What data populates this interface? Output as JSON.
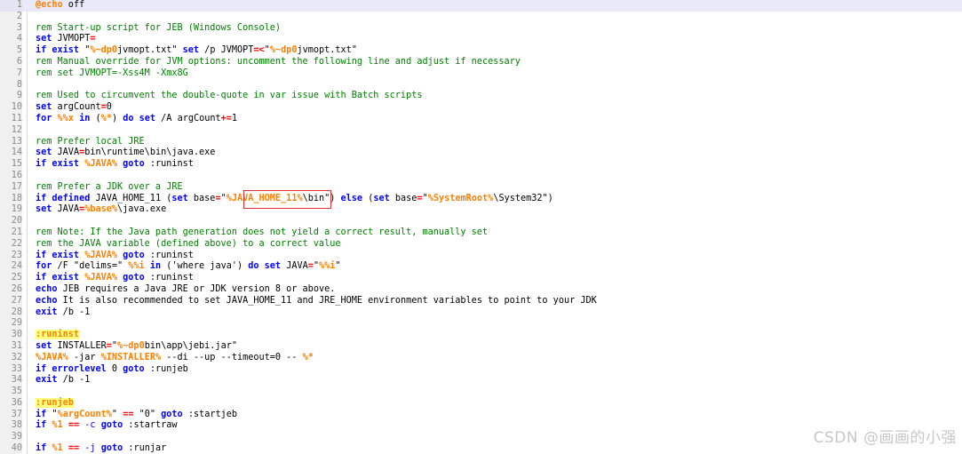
{
  "editor": {
    "lines": [
      {
        "n": "1",
        "tokens": [
          {
            "t": "@echo",
            "c": "kw-echo"
          },
          {
            "t": " off",
            "c": "plain"
          }
        ]
      },
      {
        "n": "2",
        "tokens": []
      },
      {
        "n": "3",
        "tokens": [
          {
            "t": "rem Start-up script for JEB (Windows Console)",
            "c": "cm"
          }
        ]
      },
      {
        "n": "4",
        "tokens": [
          {
            "t": "set",
            "c": "kw"
          },
          {
            "t": " JVMOPT",
            "c": "plain"
          },
          {
            "t": "=",
            "c": "op"
          }
        ]
      },
      {
        "n": "5",
        "tokens": [
          {
            "t": "if exist",
            "c": "kw"
          },
          {
            "t": " \"",
            "c": "plain"
          },
          {
            "t": "%~dp0",
            "c": "var"
          },
          {
            "t": "jvmopt.txt\" ",
            "c": "plain"
          },
          {
            "t": "set",
            "c": "kw"
          },
          {
            "t": " /p JVMOPT",
            "c": "plain"
          },
          {
            "t": "=<",
            "c": "op"
          },
          {
            "t": "\"",
            "c": "plain"
          },
          {
            "t": "%~dp0",
            "c": "var"
          },
          {
            "t": "jvmopt.txt\"",
            "c": "plain"
          }
        ]
      },
      {
        "n": "6",
        "tokens": [
          {
            "t": "rem Manual override for JVM options: uncomment the following line and adjust if necessary",
            "c": "cm"
          }
        ]
      },
      {
        "n": "7",
        "tokens": [
          {
            "t": "rem set JVMOPT=-Xss4M -Xmx8G",
            "c": "cm"
          }
        ]
      },
      {
        "n": "8",
        "tokens": []
      },
      {
        "n": "9",
        "tokens": [
          {
            "t": "rem Used to circumvent the double-quote in var issue with Batch scripts",
            "c": "cm"
          }
        ]
      },
      {
        "n": "10",
        "tokens": [
          {
            "t": "set",
            "c": "kw"
          },
          {
            "t": " argCount",
            "c": "plain"
          },
          {
            "t": "=",
            "c": "op"
          },
          {
            "t": "0",
            "c": "plain"
          }
        ]
      },
      {
        "n": "11",
        "tokens": [
          {
            "t": "for",
            "c": "kw"
          },
          {
            "t": " ",
            "c": "plain"
          },
          {
            "t": "%%x",
            "c": "var"
          },
          {
            "t": " ",
            "c": "plain"
          },
          {
            "t": "in",
            "c": "kw"
          },
          {
            "t": " (",
            "c": "plain"
          },
          {
            "t": "%*",
            "c": "var"
          },
          {
            "t": ") ",
            "c": "plain"
          },
          {
            "t": "do set",
            "c": "kw"
          },
          {
            "t": " /A argCount",
            "c": "plain"
          },
          {
            "t": "+=",
            "c": "op"
          },
          {
            "t": "1",
            "c": "plain"
          }
        ]
      },
      {
        "n": "12",
        "tokens": []
      },
      {
        "n": "13",
        "tokens": [
          {
            "t": "rem Prefer local JRE",
            "c": "cm"
          }
        ]
      },
      {
        "n": "14",
        "tokens": [
          {
            "t": "set",
            "c": "kw"
          },
          {
            "t": " JAVA",
            "c": "plain"
          },
          {
            "t": "=",
            "c": "op"
          },
          {
            "t": "bin\\runtime\\bin\\java.exe",
            "c": "plain"
          }
        ]
      },
      {
        "n": "15",
        "tokens": [
          {
            "t": "if exist",
            "c": "kw"
          },
          {
            "t": " ",
            "c": "plain"
          },
          {
            "t": "%JAVA%",
            "c": "var"
          },
          {
            "t": " ",
            "c": "plain"
          },
          {
            "t": "goto",
            "c": "kw"
          },
          {
            "t": " :runinst",
            "c": "plain"
          }
        ]
      },
      {
        "n": "16",
        "tokens": []
      },
      {
        "n": "17",
        "tokens": [
          {
            "t": "rem Prefer a JDK over a JRE",
            "c": "cm"
          }
        ]
      },
      {
        "n": "18",
        "tokens": [
          {
            "t": "if defined",
            "c": "kw"
          },
          {
            "t": " JAVA_HOME_11 (",
            "c": "plain"
          },
          {
            "t": "set",
            "c": "kw"
          },
          {
            "t": " base",
            "c": "plain"
          },
          {
            "t": "=",
            "c": "op"
          },
          {
            "t": "\"",
            "c": "plain"
          },
          {
            "t": "%JAVA_HOME_11%",
            "c": "var"
          },
          {
            "t": "\\bin\") ",
            "c": "plain"
          },
          {
            "t": "else",
            "c": "kw"
          },
          {
            "t": " (",
            "c": "plain"
          },
          {
            "t": "set",
            "c": "kw"
          },
          {
            "t": " base",
            "c": "plain"
          },
          {
            "t": "=",
            "c": "op"
          },
          {
            "t": "\"",
            "c": "plain"
          },
          {
            "t": "%SystemRoot%",
            "c": "var"
          },
          {
            "t": "\\System32\")",
            "c": "plain"
          }
        ]
      },
      {
        "n": "19",
        "tokens": [
          {
            "t": "set",
            "c": "kw"
          },
          {
            "t": " JAVA",
            "c": "plain"
          },
          {
            "t": "=",
            "c": "op"
          },
          {
            "t": "%base%",
            "c": "var"
          },
          {
            "t": "\\java.exe",
            "c": "plain"
          }
        ]
      },
      {
        "n": "20",
        "tokens": []
      },
      {
        "n": "21",
        "tokens": [
          {
            "t": "rem Note: If the Java path generation does not yield a correct result, manually set",
            "c": "cm"
          }
        ]
      },
      {
        "n": "22",
        "tokens": [
          {
            "t": "rem the JAVA variable (defined above) to a correct value",
            "c": "cm"
          }
        ]
      },
      {
        "n": "23",
        "tokens": [
          {
            "t": "if exist",
            "c": "kw"
          },
          {
            "t": " ",
            "c": "plain"
          },
          {
            "t": "%JAVA%",
            "c": "var"
          },
          {
            "t": " ",
            "c": "plain"
          },
          {
            "t": "goto",
            "c": "kw"
          },
          {
            "t": " :runinst",
            "c": "plain"
          }
        ]
      },
      {
        "n": "24",
        "tokens": [
          {
            "t": "for",
            "c": "kw"
          },
          {
            "t": " /F \"delims=\" ",
            "c": "plain"
          },
          {
            "t": "%%i",
            "c": "var"
          },
          {
            "t": " ",
            "c": "plain"
          },
          {
            "t": "in",
            "c": "kw"
          },
          {
            "t": " ('where java') ",
            "c": "plain"
          },
          {
            "t": "do set",
            "c": "kw"
          },
          {
            "t": " JAVA",
            "c": "plain"
          },
          {
            "t": "=",
            "c": "op"
          },
          {
            "t": "\"",
            "c": "plain"
          },
          {
            "t": "%%i",
            "c": "var"
          },
          {
            "t": "\"",
            "c": "plain"
          }
        ]
      },
      {
        "n": "25",
        "tokens": [
          {
            "t": "if exist",
            "c": "kw"
          },
          {
            "t": " ",
            "c": "plain"
          },
          {
            "t": "%JAVA%",
            "c": "var"
          },
          {
            "t": " ",
            "c": "plain"
          },
          {
            "t": "goto",
            "c": "kw"
          },
          {
            "t": " :runinst",
            "c": "plain"
          }
        ]
      },
      {
        "n": "26",
        "tokens": [
          {
            "t": "echo",
            "c": "kw"
          },
          {
            "t": " JEB requires a Java JRE or JDK version 8 or above.",
            "c": "plain"
          }
        ]
      },
      {
        "n": "27",
        "tokens": [
          {
            "t": "echo",
            "c": "kw"
          },
          {
            "t": " It is also recommended to set JAVA_HOME_11 and JRE_HOME environment variables to point to your JDK",
            "c": "plain"
          }
        ]
      },
      {
        "n": "28",
        "tokens": [
          {
            "t": "exit",
            "c": "kw"
          },
          {
            "t": " /b -1",
            "c": "plain"
          }
        ]
      },
      {
        "n": "29",
        "tokens": []
      },
      {
        "n": "30",
        "tokens": [
          {
            "t": ":runinst",
            "c": "lbl"
          }
        ]
      },
      {
        "n": "31",
        "tokens": [
          {
            "t": "set",
            "c": "kw"
          },
          {
            "t": " INSTALLER",
            "c": "plain"
          },
          {
            "t": "=",
            "c": "op"
          },
          {
            "t": "\"",
            "c": "plain"
          },
          {
            "t": "%~dp0",
            "c": "var"
          },
          {
            "t": "bin\\app\\jebi.jar\"",
            "c": "plain"
          }
        ]
      },
      {
        "n": "32",
        "tokens": [
          {
            "t": "%JAVA%",
            "c": "var"
          },
          {
            "t": " -jar ",
            "c": "plain"
          },
          {
            "t": "%INSTALLER%",
            "c": "var"
          },
          {
            "t": " --di --up --timeout=0 -- ",
            "c": "plain"
          },
          {
            "t": "%*",
            "c": "var"
          }
        ]
      },
      {
        "n": "33",
        "tokens": [
          {
            "t": "if errorlevel",
            "c": "kw"
          },
          {
            "t": " 0 ",
            "c": "plain"
          },
          {
            "t": "goto",
            "c": "kw"
          },
          {
            "t": " :runjeb",
            "c": "plain"
          }
        ]
      },
      {
        "n": "34",
        "tokens": [
          {
            "t": "exit",
            "c": "kw"
          },
          {
            "t": " /b -1",
            "c": "plain"
          }
        ]
      },
      {
        "n": "35",
        "tokens": []
      },
      {
        "n": "36",
        "tokens": [
          {
            "t": ":runjeb",
            "c": "lbl"
          }
        ]
      },
      {
        "n": "37",
        "tokens": [
          {
            "t": "if",
            "c": "kw"
          },
          {
            "t": " \"",
            "c": "plain"
          },
          {
            "t": "%argCount%",
            "c": "var"
          },
          {
            "t": "\" ",
            "c": "plain"
          },
          {
            "t": "==",
            "c": "op"
          },
          {
            "t": " \"0\" ",
            "c": "plain"
          },
          {
            "t": "goto",
            "c": "kw"
          },
          {
            "t": " :startjeb",
            "c": "plain"
          }
        ]
      },
      {
        "n": "38",
        "tokens": [
          {
            "t": "if",
            "c": "kw"
          },
          {
            "t": " ",
            "c": "plain"
          },
          {
            "t": "%1",
            "c": "var"
          },
          {
            "t": " ",
            "c": "plain"
          },
          {
            "t": "==",
            "c": "op"
          },
          {
            "t": " ",
            "c": "plain"
          },
          {
            "t": "-c",
            "c": "kwplain"
          },
          {
            "t": " ",
            "c": "plain"
          },
          {
            "t": "goto",
            "c": "kw"
          },
          {
            "t": " :startraw",
            "c": "plain"
          }
        ]
      },
      {
        "n": "39",
        "tokens": []
      },
      {
        "n": "40",
        "tokens": [
          {
            "t": "if",
            "c": "kw"
          },
          {
            "t": " ",
            "c": "plain"
          },
          {
            "t": "%1",
            "c": "var"
          },
          {
            "t": " ",
            "c": "plain"
          },
          {
            "t": "==",
            "c": "op"
          },
          {
            "t": " ",
            "c": "plain"
          },
          {
            "t": "-j",
            "c": "kwplain"
          },
          {
            "t": " ",
            "c": "plain"
          },
          {
            "t": "goto",
            "c": "kw"
          },
          {
            "t": " :runjar",
            "c": "plain"
          }
        ]
      }
    ]
  },
  "colors": {
    "keyword": "#0000ff",
    "comment": "#008000",
    "variable": "#ff8000",
    "operator": "#ff0000",
    "label_bg": "#ffff80",
    "highlight_box": "#e53030"
  },
  "watermark": {
    "text": "CSDN @画画的小强"
  }
}
